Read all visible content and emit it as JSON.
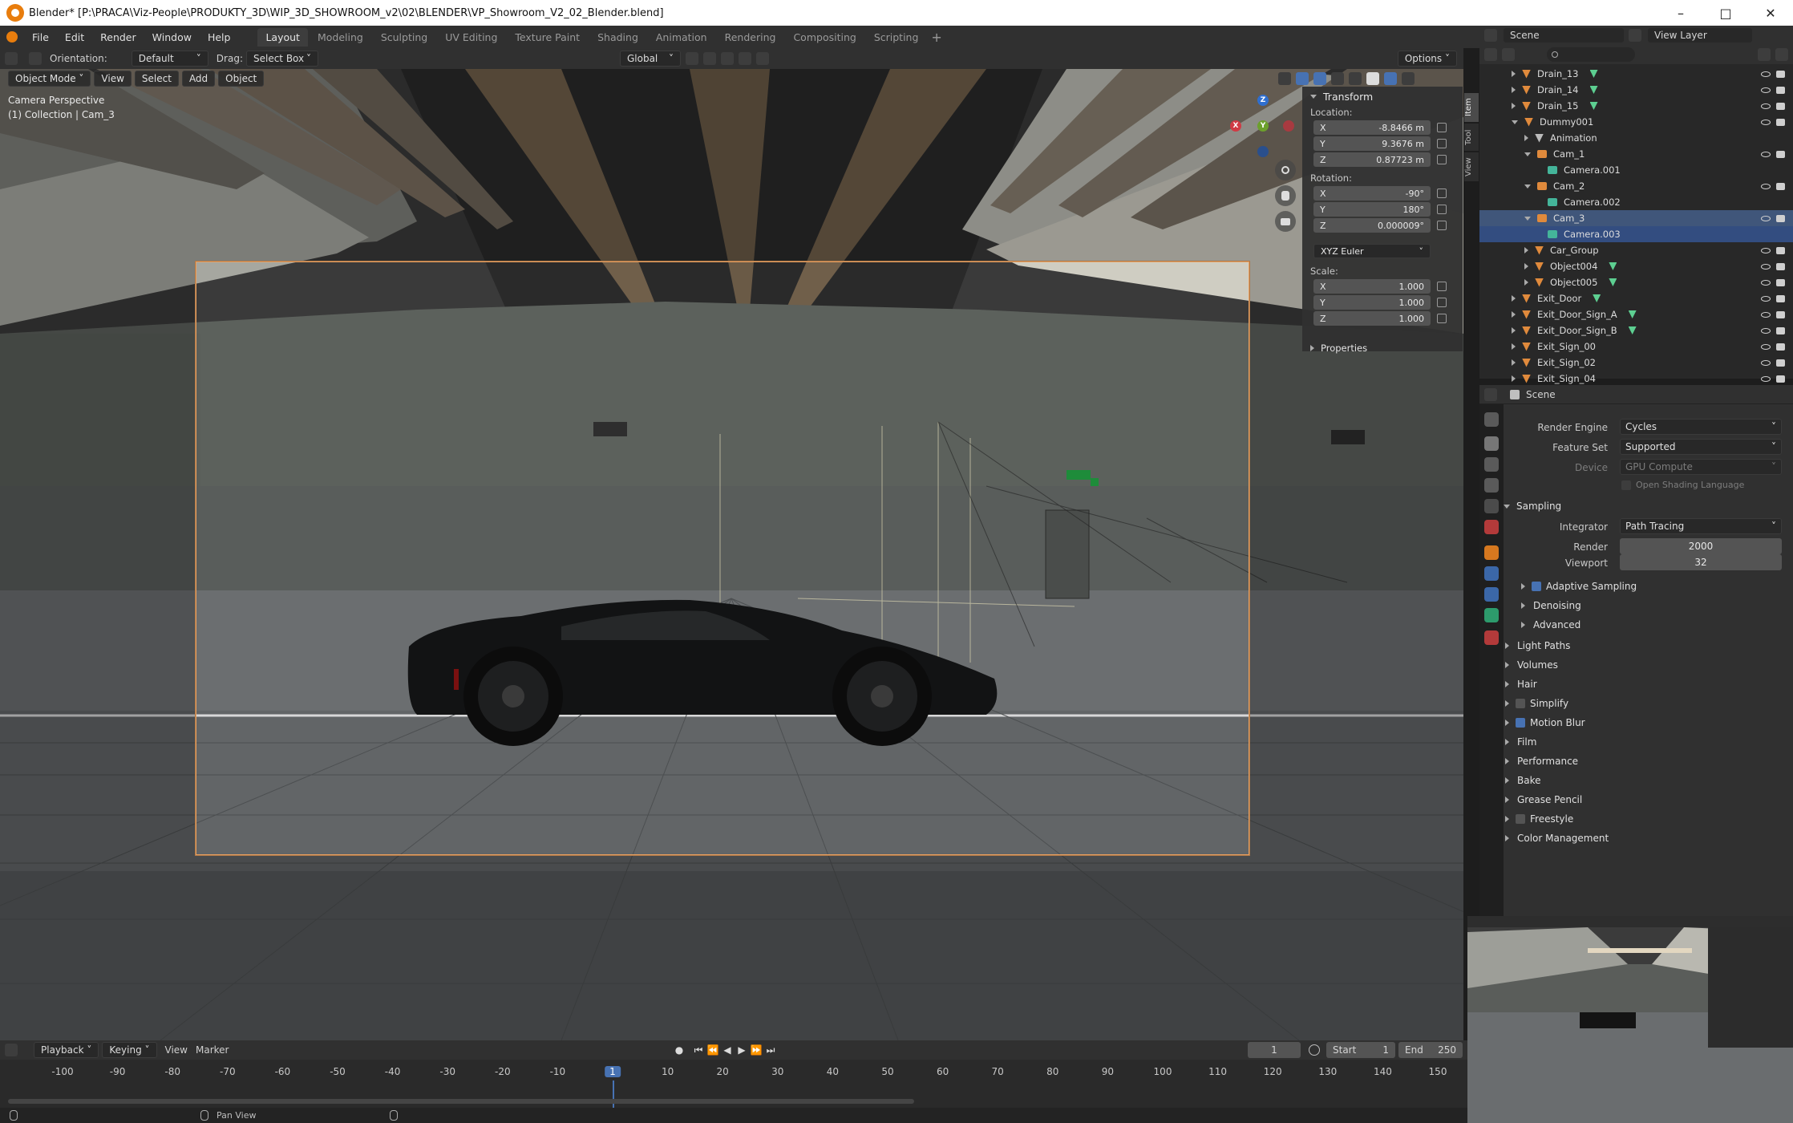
{
  "window": {
    "title": "Blender* [P:\\PRACA\\Viz-People\\PRODUKTY_3D\\WIP_3D_SHOWROOM_v2\\02\\BLENDER\\VP_Showroom_V2_02_Blender.blend]"
  },
  "menu": [
    "File",
    "Edit",
    "Render",
    "Window",
    "Help"
  ],
  "workspaces": [
    "Layout",
    "Modeling",
    "Sculpting",
    "UV Editing",
    "Texture Paint",
    "Shading",
    "Animation",
    "Rendering",
    "Compositing",
    "Scripting"
  ],
  "active_workspace": "Layout",
  "header": {
    "orientation_label": "Orientation:",
    "orientation_value": "Default",
    "drag_label": "Drag:",
    "drag_value": "Select Box",
    "transform_space": "Global",
    "options": "Options"
  },
  "viewport_header": {
    "mode": "Object Mode",
    "view": "View",
    "select": "Select",
    "add": "Add",
    "object": "Object"
  },
  "viewport": {
    "overlay_title": "Camera Perspective",
    "overlay_sub": "(1) Collection | Cam_3"
  },
  "gizmo": {
    "z": "Z",
    "y": "Y",
    "x": "X"
  },
  "npanel": {
    "section": "Transform",
    "location_label": "Location:",
    "location": [
      {
        "axis": "X",
        "value": "-8.8466 m"
      },
      {
        "axis": "Y",
        "value": "9.3676 m"
      },
      {
        "axis": "Z",
        "value": "0.87723 m"
      }
    ],
    "rotation_label": "Rotation:",
    "rotation": [
      {
        "axis": "X",
        "value": "-90°"
      },
      {
        "axis": "Y",
        "value": "180°"
      },
      {
        "axis": "Z",
        "value": "0.000009°"
      }
    ],
    "rotation_mode": "XYZ Euler",
    "scale_label": "Scale:",
    "scale": [
      {
        "axis": "X",
        "value": "1.000"
      },
      {
        "axis": "Y",
        "value": "1.000"
      },
      {
        "axis": "Z",
        "value": "1.000"
      }
    ],
    "properties": "Properties",
    "side_tabs": [
      "Item",
      "Tool",
      "View"
    ]
  },
  "topright": {
    "scene": "Scene",
    "view_layer": "View Layer"
  },
  "outliner": [
    {
      "name": "Drain_13",
      "indent": 1,
      "type": "obj",
      "extra": "mesh"
    },
    {
      "name": "Drain_14",
      "indent": 1,
      "type": "obj",
      "extra": "mesh"
    },
    {
      "name": "Drain_15",
      "indent": 1,
      "type": "obj",
      "extra": "mesh"
    },
    {
      "name": "Dummy001",
      "indent": 1,
      "type": "obj",
      "extra": ""
    },
    {
      "name": "Animation",
      "indent": 2,
      "type": "anim",
      "extra": ""
    },
    {
      "name": "Cam_1",
      "indent": 2,
      "type": "cam",
      "extra": ""
    },
    {
      "name": "Camera.001",
      "indent": 3,
      "type": "camdata",
      "extra": ""
    },
    {
      "name": "Cam_2",
      "indent": 2,
      "type": "cam",
      "extra": ""
    },
    {
      "name": "Camera.002",
      "indent": 3,
      "type": "camdata",
      "extra": ""
    },
    {
      "name": "Cam_3",
      "indent": 2,
      "type": "cam",
      "extra": ""
    },
    {
      "name": "Camera.003",
      "indent": 3,
      "type": "camdata",
      "extra": ""
    },
    {
      "name": "Car_Group",
      "indent": 2,
      "type": "obj",
      "extra": ""
    },
    {
      "name": "Object004",
      "indent": 2,
      "type": "obj",
      "extra": "mesh"
    },
    {
      "name": "Object005",
      "indent": 2,
      "type": "obj",
      "extra": "mesh"
    },
    {
      "name": "Exit_Door",
      "indent": 1,
      "type": "obj",
      "extra": "mesh"
    },
    {
      "name": "Exit_Door_Sign_A",
      "indent": 1,
      "type": "obj",
      "extra": "mesh"
    },
    {
      "name": "Exit_Door_Sign_B",
      "indent": 1,
      "type": "obj",
      "extra": "mesh"
    },
    {
      "name": "Exit_Sign_00",
      "indent": 1,
      "type": "obj",
      "extra": ""
    },
    {
      "name": "Exit_Sign_02",
      "indent": 1,
      "type": "obj",
      "extra": ""
    },
    {
      "name": "Exit_Sign_04",
      "indent": 1,
      "type": "obj",
      "extra": ""
    }
  ],
  "properties": {
    "context": "Scene",
    "render_engine_label": "Render Engine",
    "render_engine": "Cycles",
    "feature_set_label": "Feature Set",
    "feature_set": "Supported",
    "device_label": "Device",
    "device": "GPU Compute",
    "osl": "Open Shading Language",
    "sampling": "Sampling",
    "integrator_label": "Integrator",
    "integrator": "Path Tracing",
    "render_label": "Render",
    "render_samples": "2000",
    "viewport_label": "Viewport",
    "viewport_samples": "32",
    "subsections": [
      {
        "label": "Adaptive Sampling",
        "checkbox": true,
        "checked": true
      },
      {
        "label": "Denoising",
        "checkbox": false
      },
      {
        "label": "Advanced",
        "checkbox": false
      }
    ],
    "panels": [
      {
        "label": "Light Paths",
        "checkbox": false
      },
      {
        "label": "Volumes",
        "checkbox": false
      },
      {
        "label": "Hair",
        "checkbox": false
      },
      {
        "label": "Simplify",
        "checkbox": true,
        "checked": false
      },
      {
        "label": "Motion Blur",
        "checkbox": true,
        "checked": true
      },
      {
        "label": "Film",
        "checkbox": false
      },
      {
        "label": "Performance",
        "checkbox": false
      },
      {
        "label": "Bake",
        "checkbox": false
      },
      {
        "label": "Grease Pencil",
        "checkbox": false
      },
      {
        "label": "Freestyle",
        "checkbox": true,
        "checked": false
      },
      {
        "label": "Color Management",
        "checkbox": false
      }
    ]
  },
  "timeline": {
    "playback": "Playback",
    "keying": "Keying",
    "view": "View",
    "marker": "Marker",
    "current_frame": "1",
    "start_label": "Start",
    "start": "1",
    "end_label": "End",
    "end": "250",
    "ruler": [
      "-100",
      "-90",
      "-80",
      "-70",
      "-60",
      "-50",
      "-40",
      "-30",
      "-20",
      "-10",
      "1",
      "10",
      "20",
      "30",
      "40",
      "50",
      "60",
      "70",
      "80",
      "90",
      "100",
      "110",
      "120",
      "130",
      "140",
      "150"
    ]
  },
  "status": {
    "pan_view": "Pan View"
  },
  "colors": {
    "accent": "#4772b3",
    "selection": "#334d80",
    "object_orange": "#e08a3c",
    "camera_frame": "#e8a060"
  }
}
